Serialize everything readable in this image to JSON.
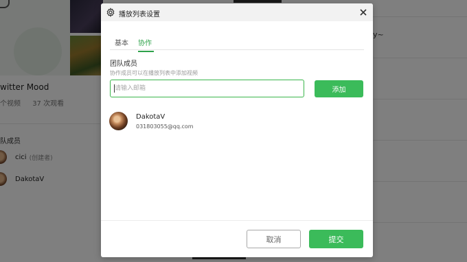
{
  "background": {
    "playlist_title": "witter Mood",
    "stats": [
      "个视频",
      "37 次观看"
    ],
    "members_heading": "队成员",
    "members": [
      {
        "name": "cici",
        "role": "(创建者)"
      },
      {
        "name": "DakotaV",
        "role": ""
      }
    ],
    "right_snippet": "y~"
  },
  "modal": {
    "title": "播放列表设置",
    "tabs": [
      {
        "label": "基本",
        "active": false
      },
      {
        "label": "协作",
        "active": true
      }
    ],
    "section_title": "团队成员",
    "section_hint": "协作成员可以在播放列表中添加视频",
    "email_input": {
      "value": "",
      "placeholder": "请输入邮箱"
    },
    "add_label": "添加",
    "members": [
      {
        "name": "DakotaV",
        "email": "031803055@qq.com"
      }
    ],
    "cancel_label": "取消",
    "submit_label": "提交"
  },
  "colors": {
    "accent": "#3bbb5a",
    "overlay": "rgba(0,0,0,0.5)"
  },
  "icons": [
    "gear-icon",
    "close-icon"
  ]
}
